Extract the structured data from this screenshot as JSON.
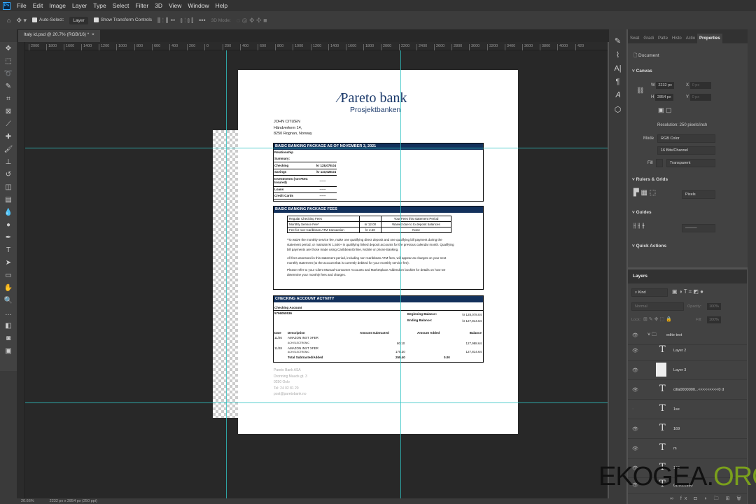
{
  "menu": [
    "File",
    "Edit",
    "Image",
    "Layer",
    "Type",
    "Select",
    "Filter",
    "3D",
    "View",
    "Window",
    "Help"
  ],
  "app_icon": "Ps",
  "options": {
    "auto_select": "Auto-Select:",
    "layer_select": "Layer",
    "show_transform": "Show Transform Controls",
    "three_d_mode": "3D Mode:"
  },
  "doc_tab": {
    "title": "Italy id.psd @ 20.7% (RGB/16) *",
    "close": "×"
  },
  "ruler_h": [
    "2000",
    "1800",
    "1600",
    "1400",
    "1200",
    "1000",
    "800",
    "600",
    "400",
    "200",
    "0",
    "200",
    "400",
    "600",
    "800",
    "1000",
    "1200",
    "1400",
    "1600",
    "1800",
    "2000",
    "2200",
    "2400",
    "2600",
    "2800",
    "3000",
    "3200",
    "3400",
    "3600",
    "3800",
    "4000",
    "420"
  ],
  "status": {
    "zoom": "20.66%",
    "size": "2232 px x 2854 px (250 ppi)"
  },
  "document": {
    "logo": {
      "name": "Pareto bank",
      "sub": "Prosjektbanken"
    },
    "address": [
      "JOHN CITIZEN",
      "Händverkem 14,",
      "8250 Rognan, Norway"
    ],
    "s1": {
      "title": "BASIC BANKING PACKAGE AS OF NOVEMBER 3, 2021",
      "rel1": "Relationship",
      "rel2": "Summary:",
      "rows": [
        {
          "k": "Checking",
          "v": "kr 128,078.04"
        },
        {
          "k": "Savings",
          "v": "kr 110,028.04"
        },
        {
          "k": "Investments (not FDIC Insured)",
          "v": "------"
        },
        {
          "k": "Loans",
          "v": "------"
        },
        {
          "k": "Credit Cards",
          "v": "------"
        }
      ]
    },
    "s2": {
      "title": "BASIC BANKING PACKAGE FEES",
      "fees": [
        [
          "Regular Checking Fees",
          "",
          "Your Fees this statement Period"
        ],
        [
          "Monthly Service Fee*",
          "kr 12.00",
          "Waived due to to deposit balances"
        ],
        [
          "Fee for non-Caribbean ATM transaction",
          "kr 2.50",
          "None"
        ]
      ],
      "p1": "*To waive the monthly service fee, make one qualifying direct deposit and one qualifying bill payment during the statement period, or maintain kr 1,500+ in qualifying linked deposit accounts for the previous calendar month. Qualifying bill payments are those made using CaribbeanOnline, Mobile or phone Banking.",
      "p2": "All fees assessed in this statement period, including non-Caribbean ATM fees, will appear as charges on your next monthly statement (to the account that is currently debited for your monthly service fee).",
      "p3": "Please refer to your Client Manual-Consumer Accounts and Marketplace Addendum booklet for details on how we determine your monthly fees and charges."
    },
    "s3": {
      "title": "CHECKING ACCOUNT ACTIVITY",
      "account_label": "Checking Account",
      "account_no": "5796050536",
      "begin_label": "Beginning Balance:",
      "begin": "kr 128,078.04",
      "end_label": "Ending Balance:",
      "end": "kr 127,814.64",
      "headers": [
        "Date",
        "Description",
        "Amount Subtracted",
        "Amount Added",
        "Balance"
      ],
      "tx": [
        {
          "date": "11/26",
          "desc": "AMAZON INST XFER",
          "sub": "ACH ELECTRONIC",
          "amt": "80.10",
          "bal": "127,988.64"
        },
        {
          "date": "11/28",
          "desc": "AMAZON INST XFER",
          "sub": "ACH ELECTRONIC",
          "amt": "175.30",
          "bal": "127,814.64"
        }
      ],
      "total_label": "Total Subtracted/Added",
      "total_sub": "255.40",
      "total_add": "0.00"
    },
    "footer": [
      "Pareto Bank ASA",
      "Dronning Mauds gt. 3",
      "0250 Oslo",
      "Tel: 24 02 81 20",
      "post@paretobank.no"
    ]
  },
  "properties": {
    "tabs": [
      "Swat",
      "Gradi",
      "Patte",
      "Histo",
      "Actio",
      "Properties"
    ],
    "doc": "Document",
    "canvas": "Canvas",
    "w_label": "W",
    "w": "2232 px",
    "h_label": "H",
    "h": "2854 px",
    "x_label": "X",
    "x": "0 px",
    "y_label": "Y",
    "y": "0 px",
    "resolution": "Resolution: 250 pixels/inch",
    "mode_label": "Mode",
    "mode": "RGB Color",
    "depth": "16 Bits/Channel",
    "fill_label": "Fill",
    "fill": "Transparent",
    "rulers": "Rulers & Grids",
    "units": "Pixels",
    "guides": "Guides",
    "quick": "Quick Actions"
  },
  "layers": {
    "title": "Layers",
    "kind": "Kind",
    "blend": "Normal",
    "opacity_label": "Opacity:",
    "opacity": "100%",
    "lock_label": "Lock:",
    "fill_label": "Fill:",
    "fill": "100%",
    "items": [
      "edite text",
      "Layer 2",
      "Layer 3",
      "cilla0000000...<<<<<<<<<0 d",
      "1se",
      "169",
      "m",
      "125",
      "01.01.1990"
    ]
  },
  "watermark": {
    "a": "EKOGEA.",
    "b": "ORG"
  }
}
